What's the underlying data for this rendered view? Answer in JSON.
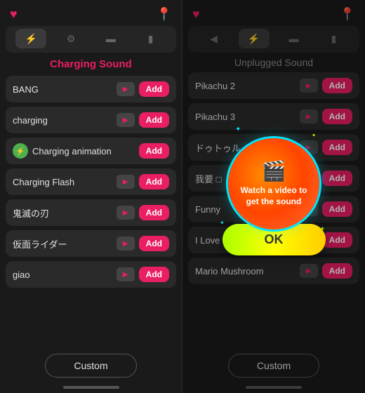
{
  "left_panel": {
    "section_title": "Charging Sound",
    "tabs": [
      {
        "icon": "⚡",
        "active": true
      },
      {
        "icon": "⚙",
        "active": false
      },
      {
        "icon": "▬",
        "active": false
      },
      {
        "icon": "▮▯",
        "active": false
      }
    ],
    "items": [
      {
        "name": "BANG",
        "has_anim": false
      },
      {
        "name": "charging",
        "has_anim": false
      },
      {
        "name": "Charging animation",
        "has_anim": true
      },
      {
        "name": "Charging Flash",
        "has_anim": false
      },
      {
        "name": "鬼滅の刃",
        "has_anim": false
      },
      {
        "name": "仮面ライダー",
        "has_anim": false
      },
      {
        "name": "giao",
        "has_anim": false
      }
    ],
    "add_label": "Add",
    "custom_label": "Custom"
  },
  "right_panel": {
    "section_title": "Unplugged Sound",
    "items": [
      {
        "name": "Pikachu 2"
      },
      {
        "name": "Pikachu 3"
      },
      {
        "name": "ドゥトゥル"
      },
      {
        "name": "我要 □"
      },
      {
        "name": "Funny"
      },
      {
        "name": "I Love You 3000"
      },
      {
        "name": "Mario Mushroom"
      }
    ],
    "add_label": "Add",
    "custom_label": "Custom"
  },
  "dialog": {
    "watch_text": "Watch a video to get the sound",
    "ok_label": "OK"
  },
  "icons": {
    "heart": "♥",
    "location": "📍",
    "play": "▶",
    "lightning": "⚡",
    "clapperboard": "🎬"
  }
}
